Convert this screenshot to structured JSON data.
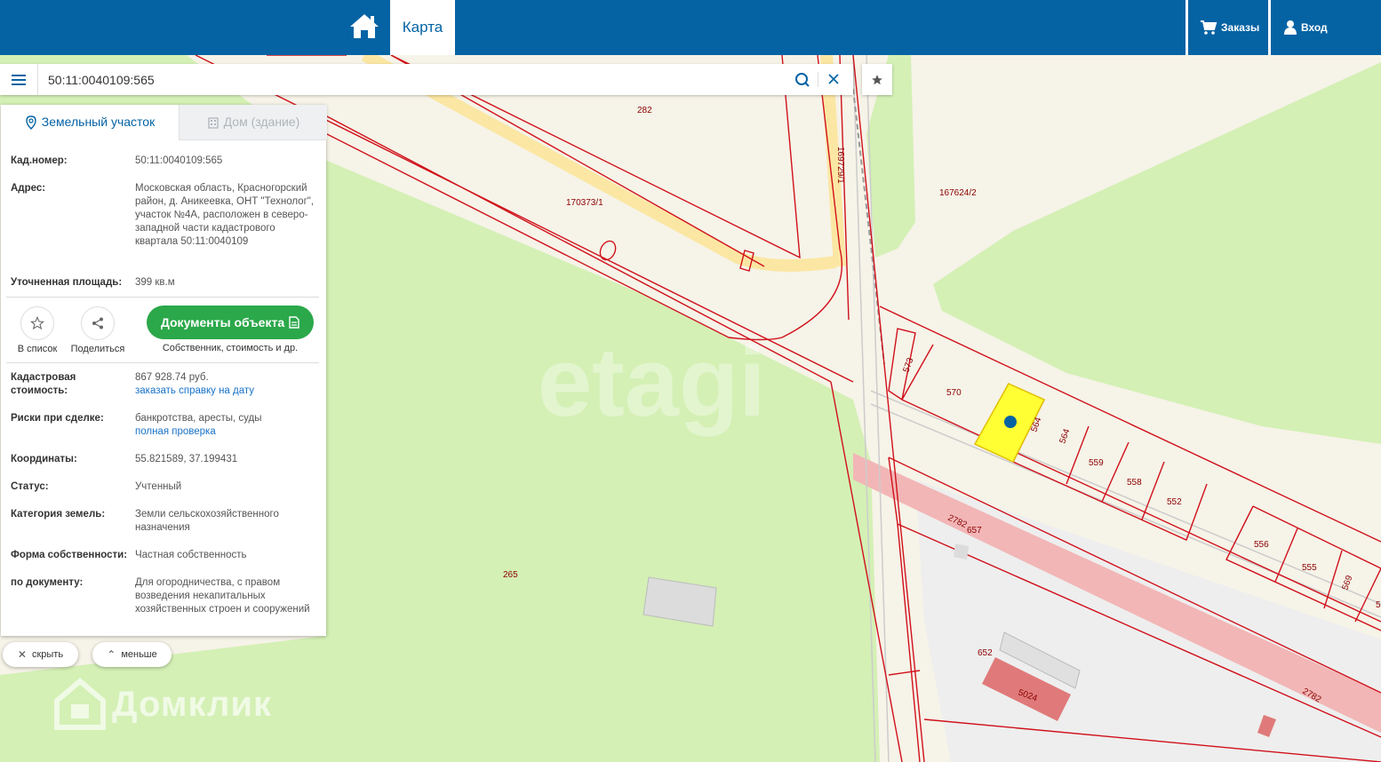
{
  "topbar": {
    "home_icon": "home-icon",
    "map_tab": "Карта",
    "orders": "Заказы",
    "login": "Вход"
  },
  "search": {
    "value": "50:11:0040109:565"
  },
  "panel": {
    "tabs": [
      "Земельный участок",
      "Дом (здание)"
    ],
    "cad_number_label": "Кад.номер:",
    "cad_number_value": "50:11:0040109:565",
    "address_label": "Адрес:",
    "address_value": "Московская область, Красногорский район, д. Аникеевка, ОНТ \"Технолог\", участок №4А, расположен в северо-западной части кадастрового квартала 50:11:0040109",
    "area_label": "Уточненная площадь:",
    "area_value": "399 кв.м",
    "add_to_list": "В список",
    "share": "Поделиться",
    "docs_button": "Документы объекта",
    "docs_sub": "Собственник, стоимость и др.",
    "cad_cost_label": "Кадастровая стоимость:",
    "cad_cost_value": "867 928.74 руб.",
    "cad_cost_link": "заказать справку на дату",
    "risks_label": "Риски при сделке:",
    "risks_value": "банкротства, аресты, суды",
    "risks_link": "полная проверка",
    "coords_label": "Координаты:",
    "coords_value": "55.821589, 37.199431",
    "status_label": "Статус:",
    "status_value": "Учтенный",
    "category_label": "Категория земель:",
    "category_value": "Земли сельскохозяйственного назначения",
    "ownership_label": "Форма собственности:",
    "ownership_value": "Частная собственность",
    "by_doc_label": "по документу:",
    "by_doc_value": "Для огородничества, с правом возведения некапитальных хозяйственных строен и сооружений"
  },
  "controls": {
    "hide": "скрыть",
    "less": "меньше"
  },
  "map": {
    "labels": [
      "282",
      "170373/1",
      "169729/1",
      "167624/2",
      "573",
      "570",
      "564",
      "564",
      "559",
      "558",
      "552",
      "556",
      "555",
      "569",
      "5",
      "2782",
      "657",
      "265",
      "652",
      "5024",
      "2782"
    ],
    "watermark_etagi": "etagi",
    "watermark_domclick": "Домклик"
  },
  "colors": {
    "brand": "#0563a4",
    "green_button": "#2ba84a",
    "selected_parcel": "#ffff33",
    "parcel_border": "#d0101a"
  }
}
